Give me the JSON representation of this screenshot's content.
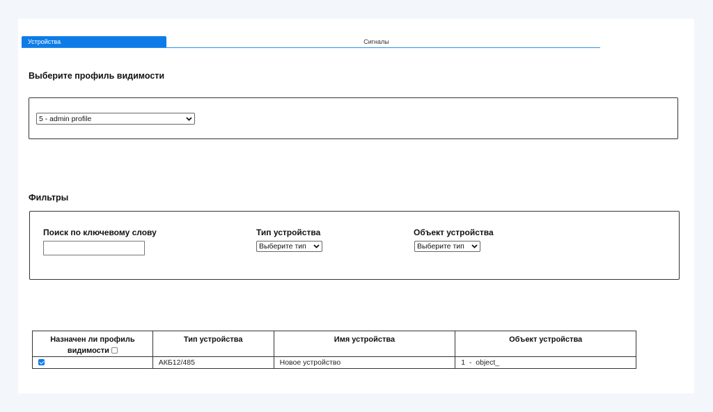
{
  "tabs": [
    {
      "label": "Устройства",
      "active": true
    },
    {
      "label": "Сигналы",
      "active": false
    }
  ],
  "profile": {
    "heading": "Выберите профиль видимости",
    "selected": "5 - admin profile"
  },
  "filters": {
    "heading": "Фильтры",
    "keyword_label": "Поиск по ключевому слову",
    "keyword_value": "",
    "type_label": "Тип устройства",
    "type_selected": "Выберите тип",
    "object_label": "Объект устройства",
    "object_selected": "Выберите тип"
  },
  "table": {
    "headers": {
      "assigned_line1": "Назначен ли профиль",
      "assigned_line2": "видимости",
      "type": "Тип устройства",
      "name": "Имя устройства",
      "object": "Объект устройства"
    },
    "header_checkbox_checked": false,
    "rows": [
      {
        "checked": true,
        "type": "АКБ12/485",
        "name": "Новое устройство",
        "object": "1  -  object_"
      }
    ]
  },
  "colors": {
    "accent": "#0d7ce8",
    "background": "#f3f7fc"
  }
}
